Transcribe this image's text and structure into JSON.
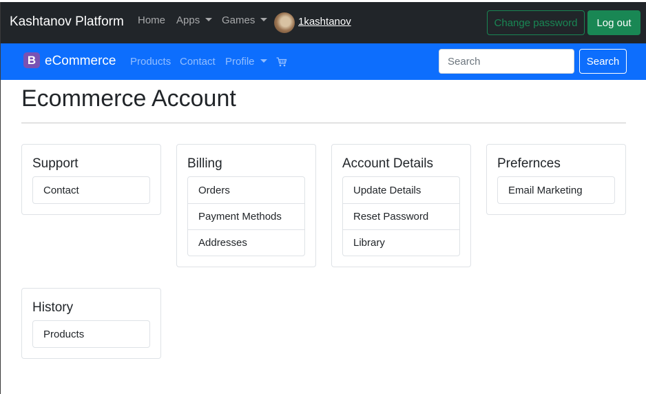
{
  "topnav": {
    "brand": "Kashtanov Platform",
    "links": [
      "Home",
      "Apps",
      "Games"
    ],
    "username": "1kashtanov",
    "change_password": "Change password",
    "logout": "Log out",
    "accent": "#198754"
  },
  "ecomnav": {
    "logo_letter": "B",
    "brand": "eCommerce",
    "links": [
      "Products",
      "Contact",
      "Profile"
    ],
    "cart_icon": "cart-icon",
    "search_placeholder": "Search",
    "search_button": "Search",
    "accent": "#0d6efd"
  },
  "page": {
    "title": "Ecommerce Account"
  },
  "cards": [
    {
      "title": "Support",
      "items": [
        "Contact"
      ]
    },
    {
      "title": "Billing",
      "items": [
        "Orders",
        "Payment Methods",
        "Addresses"
      ]
    },
    {
      "title": "Account Details",
      "items": [
        "Update Details",
        "Reset Password",
        "Library"
      ]
    },
    {
      "title": "Prefernces",
      "items": [
        "Email Marketing"
      ]
    },
    {
      "title": "History",
      "items": [
        "Products"
      ]
    }
  ]
}
